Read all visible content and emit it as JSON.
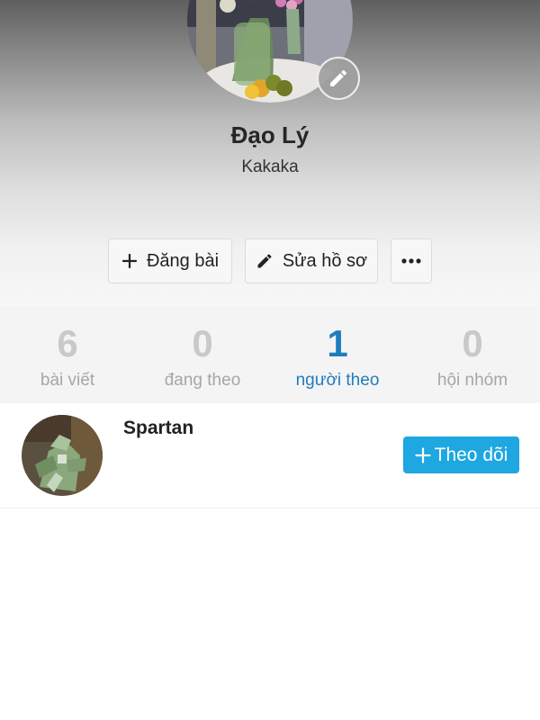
{
  "profile": {
    "name": "Đạo Lý",
    "bio": "Kakaka"
  },
  "actions": {
    "post_label": "Đăng bài",
    "edit_label": "Sửa hồ sơ"
  },
  "stats": [
    {
      "value": "6",
      "label": "bài viết"
    },
    {
      "value": "0",
      "label": "đang theo"
    },
    {
      "value": "1",
      "label": "người theo"
    },
    {
      "value": "0",
      "label": "hội nhóm"
    }
  ],
  "followers": [
    {
      "name": "Spartan",
      "follow_label": "Theo dõi"
    }
  ],
  "colors": {
    "active_tab": "#1f7dbd",
    "follow_button": "#1ea7e0",
    "stat_inactive": "#c9c9c9"
  }
}
